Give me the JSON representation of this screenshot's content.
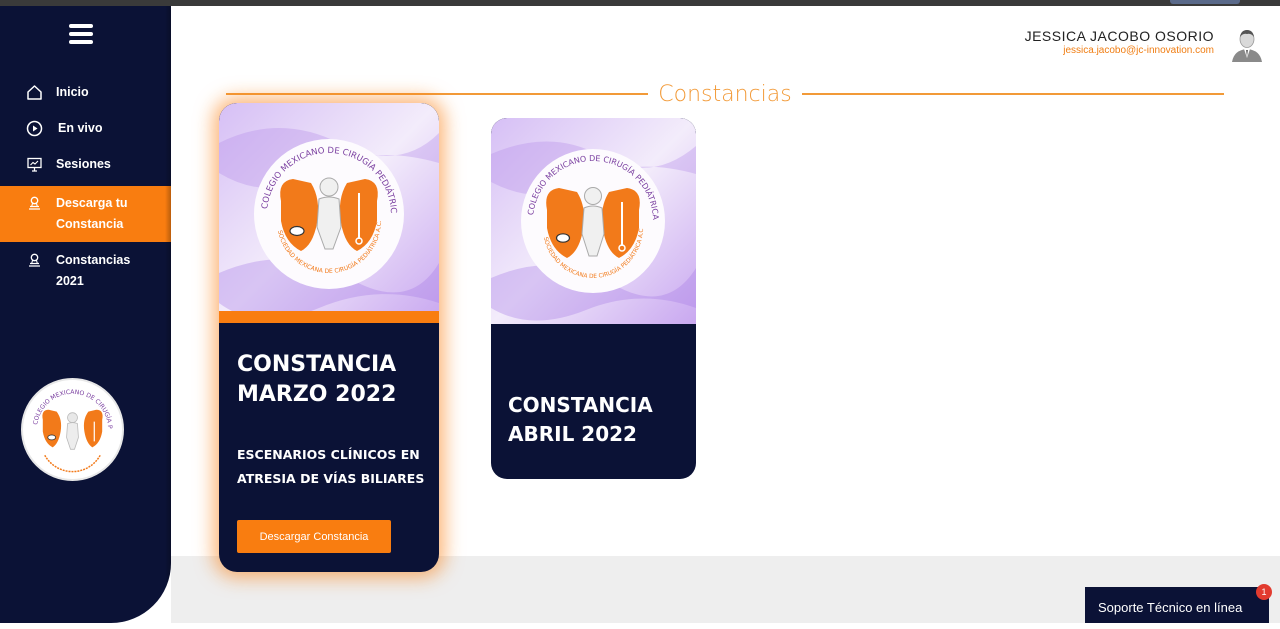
{
  "sidebar": {
    "items": [
      {
        "label": "Inicio",
        "icon": "home-icon"
      },
      {
        "label": "En vivo",
        "icon": "play-circle-icon"
      },
      {
        "label": "Sesiones",
        "icon": "presentation-icon"
      },
      {
        "label": "Descarga tu Constancia",
        "icon": "certificate-icon",
        "active": true
      },
      {
        "label": "Constancias 2021",
        "icon": "certificate-icon"
      }
    ],
    "logo_text": "COLEGIO MEXICANO DE CIRUGÍA PEDIÁTRICA A.C."
  },
  "user": {
    "name": "JESSICA JACOBO OSORIO",
    "email": "jessica.jacobo@jc-innovation.com"
  },
  "page": {
    "section_title": "Constancias"
  },
  "cards": [
    {
      "title_line1": "CONSTANCIA",
      "title_line2": "MARZO 2022",
      "subtitle_line1": "ESCENARIOS CLÍNICOS EN",
      "subtitle_line2": "ATRESIA DE VÍAS BILIARES",
      "button_label": "Descargar Constancia",
      "logo_text_outer": "COLEGIO MEXICANO DE CIRUGÍA PEDIÁTRICA A.C.",
      "logo_text_inner": "SOCIEDAD MEXICANA DE CIRUGÍA PEDIÁTRICA A.C."
    },
    {
      "title_line1": "CONSTANCIA",
      "title_line2": "ABRIL 2022",
      "logo_text_outer": "COLEGIO MEXICANO DE CIRUGÍA PEDIÁTRICA A.C.",
      "logo_text_inner": "SOCIEDAD MEXICANA DE CIRUGÍA PEDIÁTRICA A.C."
    }
  ],
  "support": {
    "label": "Soporte Técnico en línea",
    "badge_count": "1"
  },
  "colors": {
    "navy": "#0b1236",
    "accent_orange": "#f97d10",
    "title_orange": "#f29a38",
    "card_bg_lavender": "#c9a8f0"
  }
}
